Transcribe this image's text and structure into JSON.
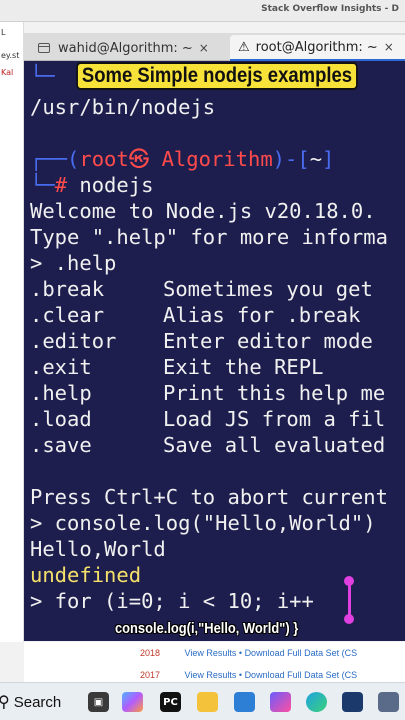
{
  "browser": {
    "title": "Stack Overflow Insights - D",
    "left_fragments": [
      "L",
      "ey.st",
      "Kal"
    ],
    "rows": [
      {
        "year": "2018",
        "view": "View Results",
        "sep": "•",
        "download": "Download Full Data Set (CS"
      },
      {
        "year": "2017",
        "view": "View Results",
        "sep": "•",
        "download": "Download Full Data Set (CS"
      }
    ]
  },
  "terminal": {
    "tabs": [
      {
        "label": "wahid@Algorithm: ~",
        "close": "×"
      },
      {
        "label": "root@Algorithm: ~",
        "close": "×"
      }
    ],
    "lines": {
      "prompt1_corner": "└─",
      "path": "/usr/bin/nodejs",
      "prompt2_a": "┌──(",
      "prompt2_user": "root㉿ Algorithm",
      "prompt2_b": ")-[",
      "prompt2_dir": "~",
      "prompt2_c": "]",
      "prompt3_a": "└─",
      "prompt3_hash": "#",
      "prompt3_cmd": " nodejs",
      "welcome": "Welcome to Node.js v20.18.0.",
      "type_help": "Type \".help\" for more informa",
      "help_cmd": "> .help",
      "help_items": [
        {
          "cmd": ".break",
          "desc": "Sometimes you get"
        },
        {
          "cmd": ".clear",
          "desc": "Alias for .break"
        },
        {
          "cmd": ".editor",
          "desc": "Enter editor mode"
        },
        {
          "cmd": ".exit",
          "desc": "Exit the REPL"
        },
        {
          "cmd": ".help",
          "desc": "Print this help me"
        },
        {
          "cmd": ".load",
          "desc": "Load JS from a fil"
        },
        {
          "cmd": ".save",
          "desc": "Save all evaluated"
        }
      ],
      "ctrl_c": "Press Ctrl+C to abort current",
      "console_cmd": "> console.log(\"Hello,World\")",
      "hello": "Hello,World",
      "undefined": "undefined",
      "for_cmd": "> for (i=0; i < 10; i++"
    }
  },
  "overlay": {
    "top_caption": "Some Simple nodejs examples",
    "bottom_caption": "console.log(i,\"Hello, World\")   }",
    "accent": "#e040e0",
    "caption_bg": "#f7e23a"
  },
  "taskbar": {
    "search_label": "Search",
    "icons": [
      "task-view-icon",
      "copilot-icon",
      "pycharm-icon",
      "file-explorer-icon",
      "store-icon",
      "edge-icon",
      "browser-icon",
      "vscode-icon",
      "cube-icon"
    ]
  }
}
